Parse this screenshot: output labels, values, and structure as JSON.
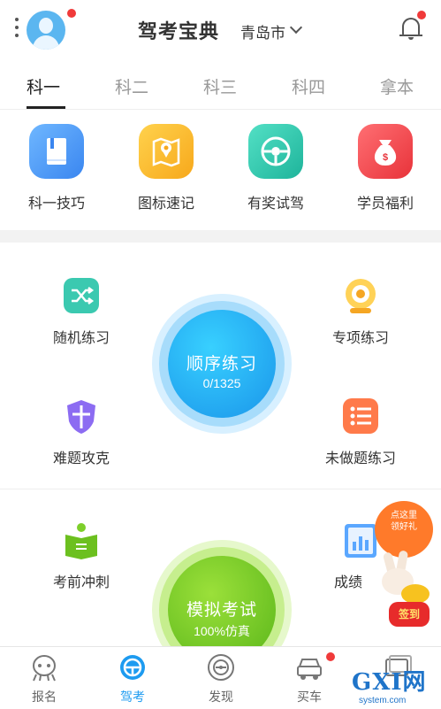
{
  "header": {
    "title": "驾考宝典",
    "city": "青岛市",
    "colors": {
      "notification_dot": "#f03a3a",
      "avatar": "#5bb6f0"
    }
  },
  "tabs": [
    {
      "label": "科一",
      "active": true
    },
    {
      "label": "科二"
    },
    {
      "label": "科三"
    },
    {
      "label": "科四"
    },
    {
      "label": "拿本"
    }
  ],
  "quick_actions": [
    {
      "label": "科一技巧",
      "icon": "book-icon"
    },
    {
      "label": "图标速记",
      "icon": "map-pin-icon"
    },
    {
      "label": "有奖试驾",
      "icon": "steering-wheel-icon"
    },
    {
      "label": "学员福利",
      "icon": "money-bag-icon"
    }
  ],
  "practice": {
    "random": "随机练习",
    "special": "专项练习",
    "hard": "难题攻克",
    "undone": "未做题练习",
    "sprint": "考前冲刺",
    "score": "成绩",
    "sequential": {
      "title": "顺序练习",
      "count": "0/1325"
    },
    "mock_exam": {
      "title": "模拟考试",
      "subtitle": "100%仿真"
    }
  },
  "promo": {
    "bubble_lines": [
      "点这里",
      "领好礼"
    ],
    "pouch": "签到"
  },
  "bottom_nav": [
    {
      "label": "报名",
      "icon": "alien-icon"
    },
    {
      "label": "驾考",
      "icon": "steering-wheel-icon",
      "active": true
    },
    {
      "label": "发现",
      "icon": "compass-icon"
    },
    {
      "label": "买车",
      "icon": "car-icon"
    },
    {
      "label": "",
      "icon": "card-icon"
    }
  ],
  "watermark": {
    "main": "GXI网",
    "sub": "system.com"
  }
}
